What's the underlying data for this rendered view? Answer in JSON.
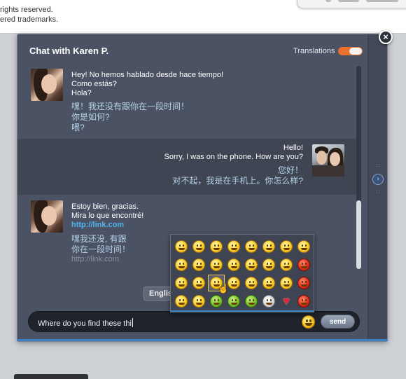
{
  "background": {
    "line1": "rights reserved.",
    "line2": "ered trademarks."
  },
  "chat": {
    "title": "Chat with Karen P.",
    "translations_label": "Translations",
    "translations_on": true,
    "close_glyph": "×",
    "messages": [
      {
        "sender": "karen",
        "original": [
          "Hey! No hemos hablado desde hace tiempo!",
          "Como estás?",
          "Hola?"
        ],
        "translated": [
          "嘿！我还没有跟你在一段时间！",
          "你是如何?",
          "喂?"
        ]
      },
      {
        "sender": "me",
        "original": [
          "Hello!",
          "Sorry, I was on the phone. How are you?"
        ],
        "translated": [
          "您好！",
          "对不起，我是在手机上。你怎么样?"
        ]
      },
      {
        "sender": "karen",
        "original": [
          "Estoy bien, gracias.",
          "Mira lo que encontré!"
        ],
        "link": "http://link.com",
        "translated": [
          "嘿我还没, 有跟",
          "你在一段时间！"
        ],
        "translated_link": "http://link.com"
      }
    ],
    "language_button": "English",
    "input_value": "Where do you find these thi",
    "send_label": "send"
  },
  "emoji_picker": {
    "selected": "grinning-face",
    "icons": [
      "smile",
      "grin",
      "wink",
      "sad",
      "confused",
      "thinking",
      "worried",
      "cry",
      "happy",
      "laugh",
      "tongue",
      "smirk",
      "tears",
      "surprised",
      "sleepy",
      "angry-red",
      "cool",
      "nerd",
      "grinning-face",
      "shocked",
      "neutral",
      "embarrassed",
      "blush",
      "devil",
      "kiss",
      "angel",
      "sick-green",
      "zombie",
      "puke-green",
      "skull",
      "heart",
      "angry-face"
    ]
  },
  "colors": {
    "window": "#4b5263",
    "band": "#3f4553",
    "accent": "#e8722b",
    "link": "#4fb6f0",
    "translation": "#b6d2ea"
  }
}
